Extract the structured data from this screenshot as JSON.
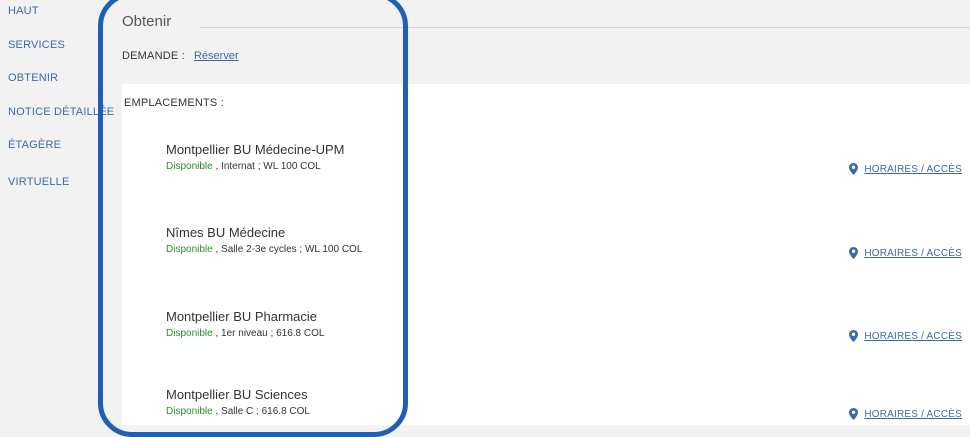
{
  "sidebar": {
    "items": [
      {
        "label": "HAUT"
      },
      {
        "label": "SERVICES"
      },
      {
        "label": "OBTENIR"
      },
      {
        "label": "NOTICE DÉTAILLÉE"
      },
      {
        "label": "ÉTAGÈRE"
      },
      {
        "label": "VIRTUELLE"
      }
    ]
  },
  "section": {
    "title": "Obtenir",
    "demande_label": "DEMANDE :",
    "demande_link": "Réserver",
    "emplacements_label": "EMPLACEMENTS :"
  },
  "locations": [
    {
      "name": "Montpellier BU Médecine-UPM",
      "status": "Disponible",
      "details": " , Internat ; WL 100 COL",
      "hours": "HORAIRES / ACCÈS"
    },
    {
      "name": "Nîmes BU Médecine",
      "status": "Disponible",
      "details": " , Salle 2-3e cycles ; WL 100 COL",
      "hours": "HORAIRES / ACCÈS"
    },
    {
      "name": "Montpellier BU Pharmacie",
      "status": "Disponible",
      "details": " , 1er niveau ; 616.8 COL",
      "hours": "HORAIRES / ACCÈS"
    },
    {
      "name": "Montpellier BU Sciences",
      "status": "Disponible",
      "details": " , Salle C ; 616.8 COL",
      "hours": "HORAIRES / ACCÈS"
    }
  ],
  "colors": {
    "link": "#3c6aa5",
    "available": "#2e8b2e",
    "highlight_border": "#1f5fb4"
  },
  "icons": {
    "hours": "map-pin-icon"
  }
}
